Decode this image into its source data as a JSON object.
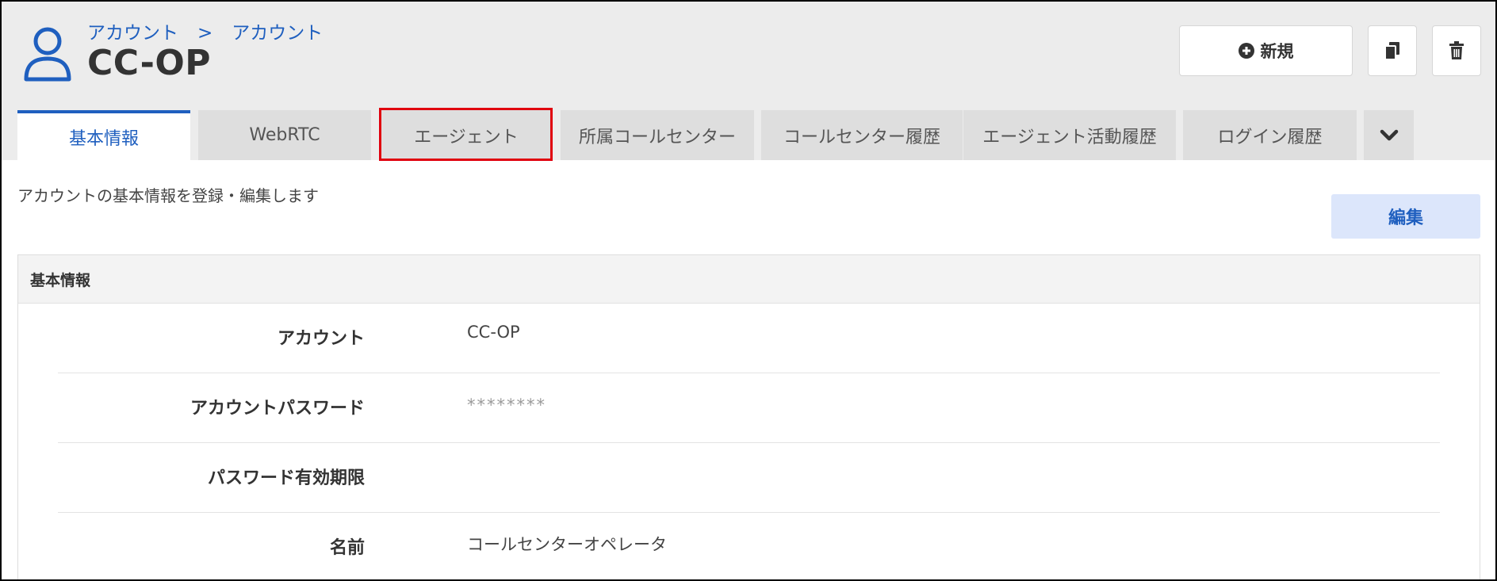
{
  "header": {
    "breadcrumb": [
      "アカウント",
      "アカウント"
    ],
    "breadcrumb_separator": ">",
    "title": "CC-OP",
    "new_button_label": "新規",
    "icons": {
      "user": "user-icon",
      "plus": "plus-circle-icon",
      "copy": "copy-icon",
      "delete": "trash-icon"
    }
  },
  "tabs": [
    {
      "label": "基本情報",
      "active": true
    },
    {
      "label": "WebRTC",
      "active": false
    },
    {
      "label": "エージェント",
      "active": false,
      "highlighted": true
    },
    {
      "label": "所属コールセンター",
      "active": false
    },
    {
      "label": "コールセンター履歴",
      "active": false
    },
    {
      "label": "エージェント活動履歴",
      "active": false
    },
    {
      "label": "ログイン履歴",
      "active": false
    }
  ],
  "tabs_more_icon": "chevron-down-icon",
  "content": {
    "description": "アカウントの基本情報を登録・編集します",
    "edit_button_label": "編集",
    "panel_title": "基本情報",
    "fields": [
      {
        "label": "アカウント",
        "value": "CC-OP"
      },
      {
        "label": "アカウントパスワード",
        "value": "********"
      },
      {
        "label": "パスワード有効期限",
        "value": ""
      },
      {
        "label": "名前",
        "value": "コールセンターオペレータ"
      }
    ]
  },
  "colors": {
    "accent": "#1f5fbf",
    "highlight_box": "#e0000e",
    "header_bg": "#ececec",
    "tab_bg": "#dedede",
    "edit_button_bg": "#dce6fb"
  }
}
